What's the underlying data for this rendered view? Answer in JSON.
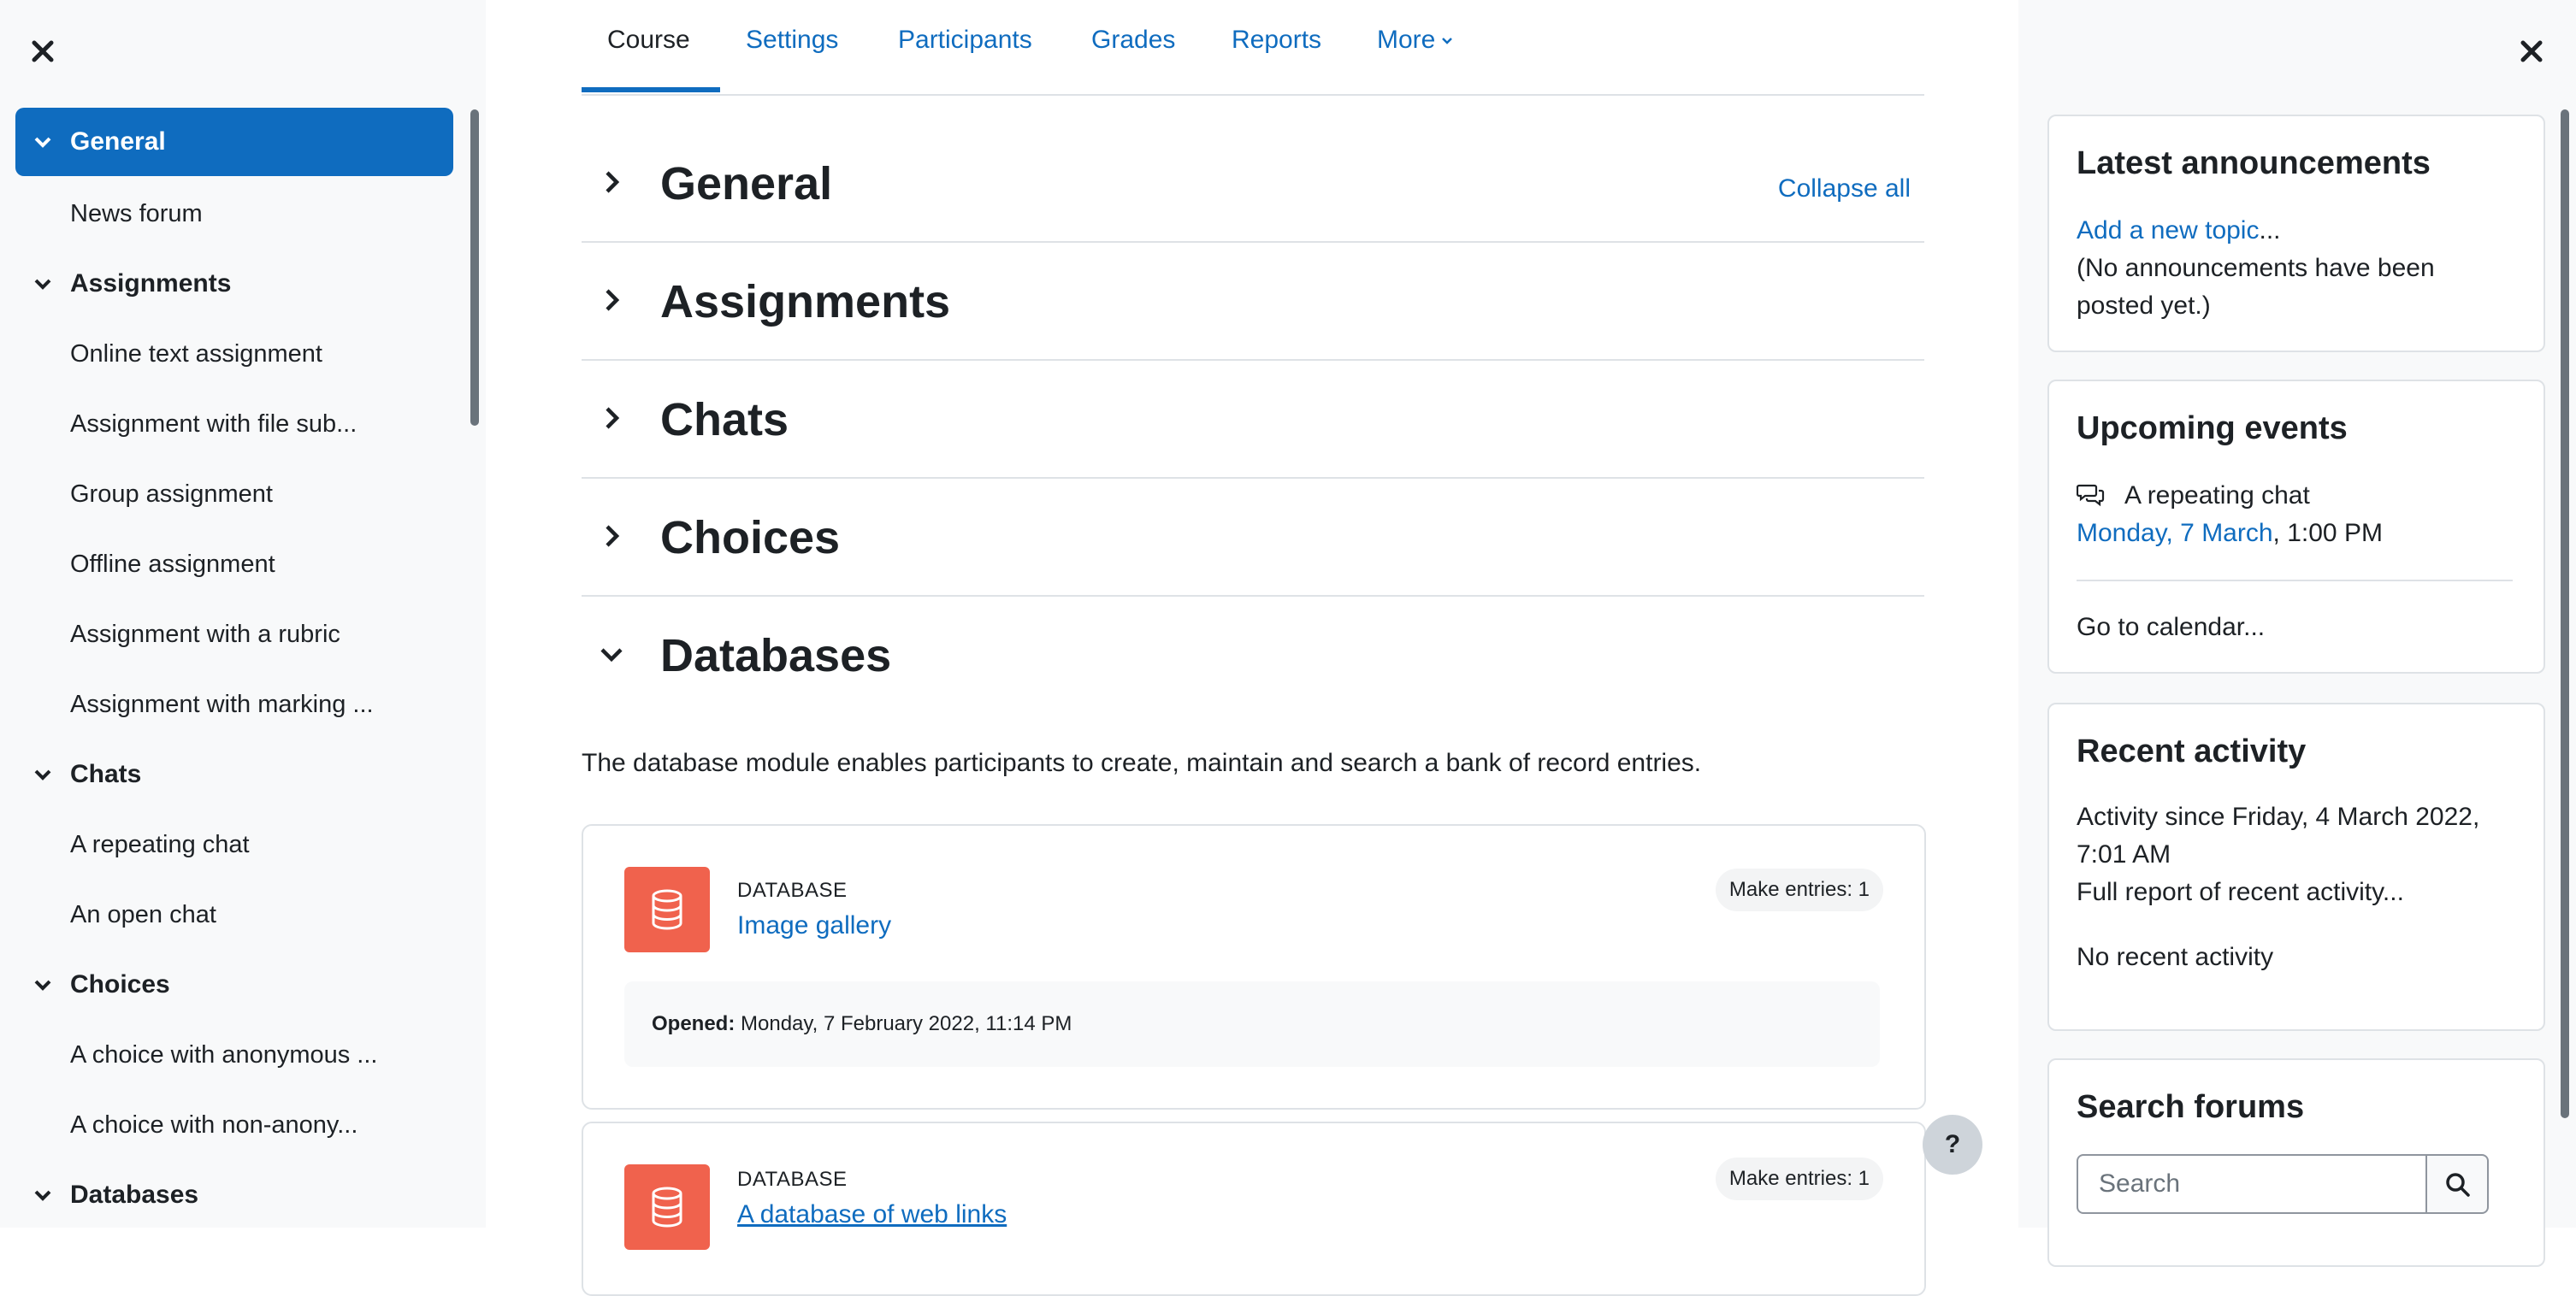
{
  "course_index": {
    "sections": [
      {
        "label": "General",
        "items": [
          "News forum"
        ]
      },
      {
        "label": "Assignments",
        "items": [
          "Online text assignment",
          "Assignment with file sub...",
          "Group assignment",
          "Offline assignment",
          "Assignment with a rubric",
          "Assignment with marking ..."
        ]
      },
      {
        "label": "Chats",
        "items": [
          "A repeating chat",
          "An open chat"
        ]
      },
      {
        "label": "Choices",
        "items": [
          "A choice with anonymous ...",
          "A choice with non-anony..."
        ]
      },
      {
        "label": "Databases",
        "items": []
      }
    ]
  },
  "tabs": [
    "Course",
    "Settings",
    "Participants",
    "Grades",
    "Reports",
    "More"
  ],
  "main": {
    "collapse_all": "Collapse all",
    "sections": [
      "General",
      "Assignments",
      "Chats",
      "Choices",
      "Databases"
    ],
    "db_summary": "The database module enables participants to create, maintain and search a bank of record entries.",
    "activities": [
      {
        "type": "DATABASE",
        "name": "Image gallery",
        "badge": "Make entries: 1",
        "dates_label": "Opened:",
        "dates_value": "Monday, 7 February 2022, 11:14 PM"
      },
      {
        "type": "DATABASE",
        "name": "A database of web links",
        "badge": "Make entries: 1"
      }
    ],
    "help": "?"
  },
  "blocks": {
    "announcements": {
      "title": "Latest announcements",
      "add_link": "Add a new topic",
      "ellipsis": "...",
      "empty": "(No announcements have been posted yet.)"
    },
    "upcoming": {
      "title": "Upcoming events",
      "event_name": "A repeating chat",
      "event_date": "Monday, 7 March",
      "event_time": ", 1:00 PM",
      "calendar_link": "Go to calendar..."
    },
    "recent": {
      "title": "Recent activity",
      "since": "Activity since Friday, 4 March 2022, 7:01 AM",
      "full_report": "Full report of recent activity...",
      "none": "No recent activity"
    },
    "search": {
      "title": "Search forums",
      "placeholder": "Search"
    }
  },
  "colors": {
    "accent": "#0f6cbf",
    "database_icon": "#f0624d",
    "drawer_bg": "#f8f9fa"
  }
}
